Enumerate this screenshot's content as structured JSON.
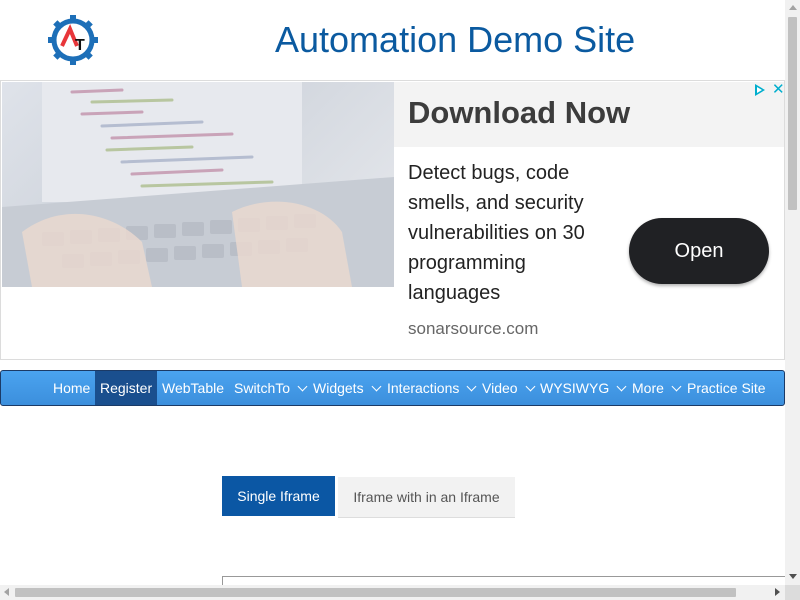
{
  "header": {
    "title": "Automation Demo Site"
  },
  "ad": {
    "headline": "Download Now",
    "body": "Detect bugs, code smells, and security vulnerabilities on 30 programming languages",
    "domain": "sonarsource.com",
    "cta": "Open"
  },
  "nav": {
    "items": [
      {
        "label": "Home"
      },
      {
        "label": "Register"
      },
      {
        "label": "WebTable"
      },
      {
        "label": "SwitchTo"
      },
      {
        "label": "Widgets"
      },
      {
        "label": "Interactions"
      },
      {
        "label": "Video"
      },
      {
        "label": "WYSIWYG"
      },
      {
        "label": "More"
      },
      {
        "label": "Practice Site"
      }
    ],
    "active": "Register"
  },
  "tabs": {
    "single": "Single Iframe",
    "nested": "Iframe with in an Iframe"
  },
  "colors": {
    "title": "#0b5aa0",
    "nav": "#3c8fdc",
    "nav_active": "#1a4f8e",
    "tab_active": "#0b57a4"
  }
}
